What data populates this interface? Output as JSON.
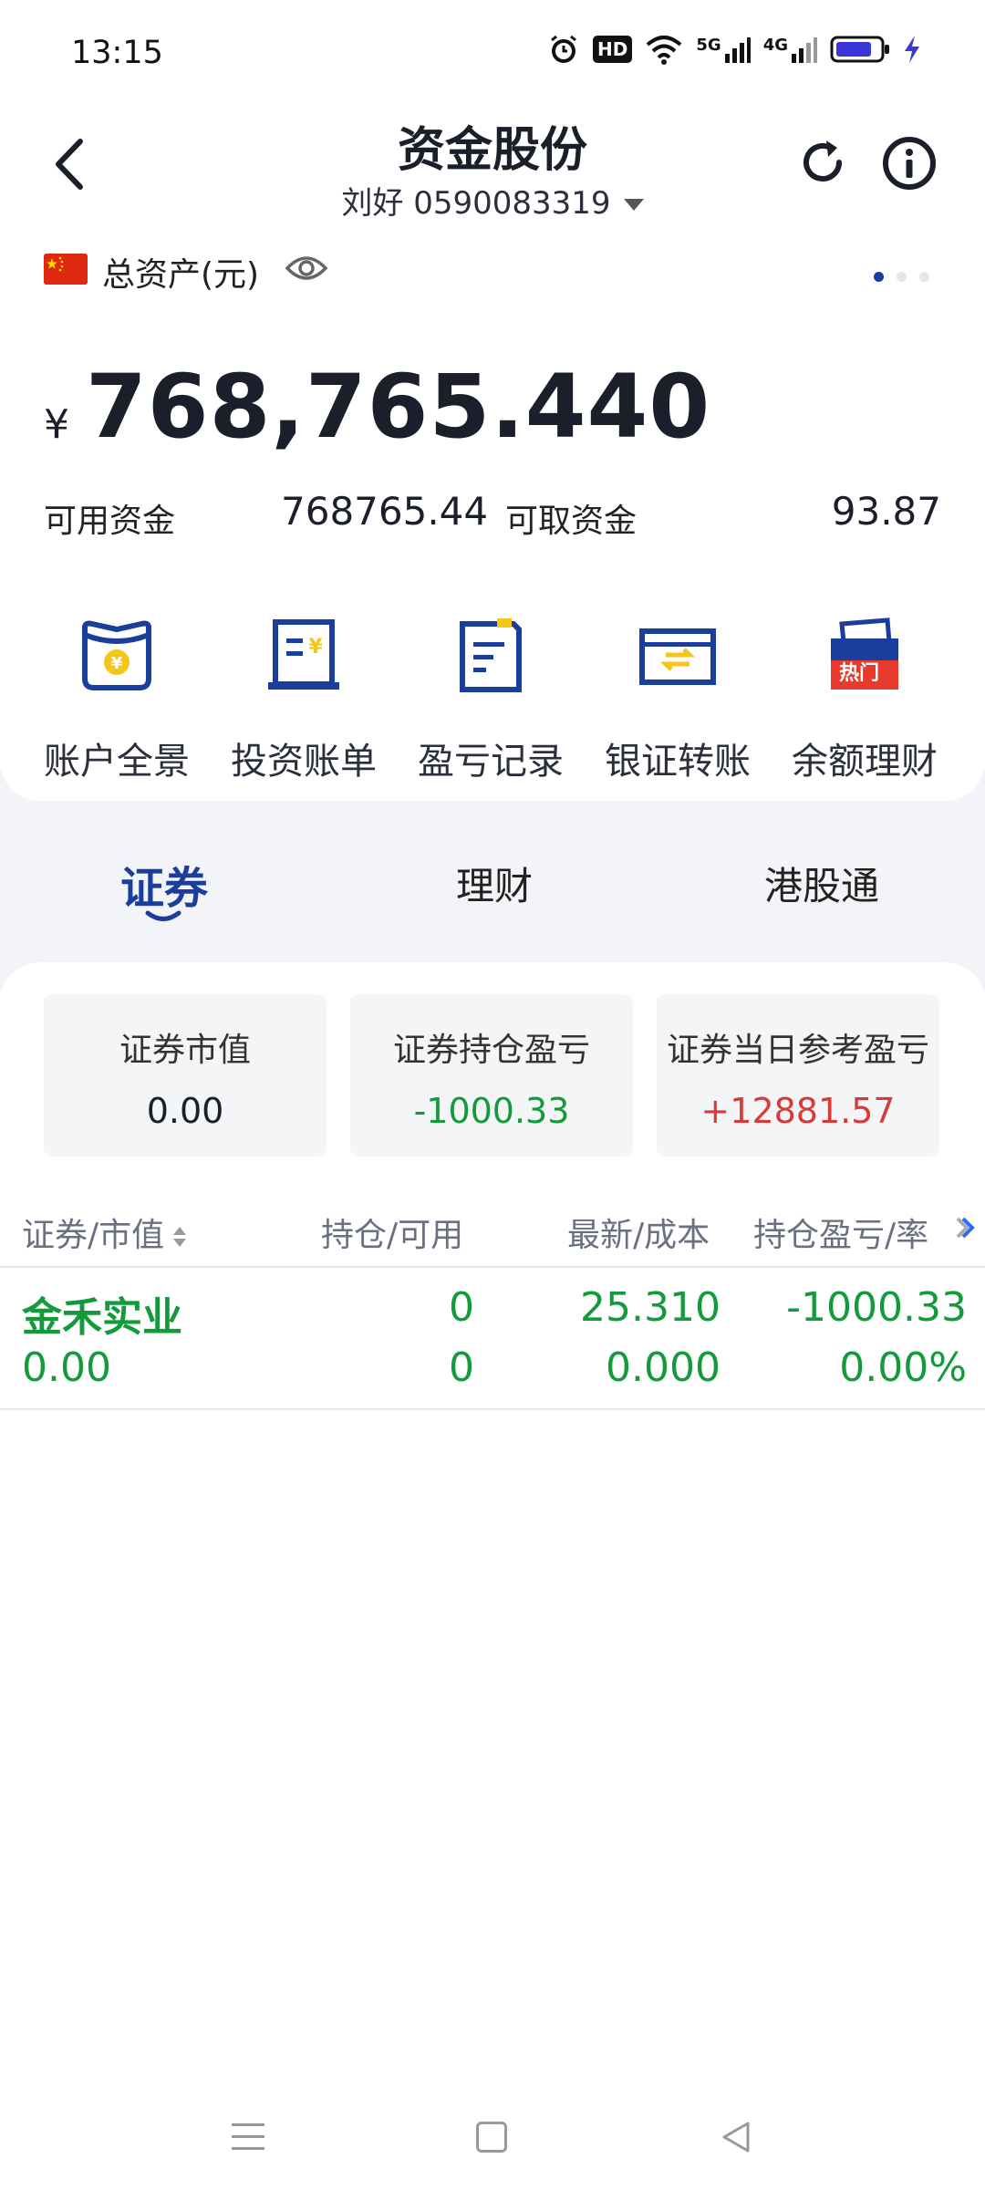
{
  "status_bar": {
    "time": "13:15",
    "hd_label": "HD",
    "net_5g": "5G",
    "net_4g": "4G"
  },
  "header": {
    "title": "资金股份",
    "account": "刘好 0590083319"
  },
  "assets": {
    "label": "总资产(元)",
    "currency_symbol": "¥",
    "total": "768,765.440",
    "available_label": "可用资金",
    "available_value": "768765.44",
    "withdrawable_label": "可取资金",
    "withdrawable_value": "93.87",
    "page_indicator_count": 3,
    "page_indicator_active": 1
  },
  "actions": [
    {
      "label": "账户全景",
      "icon": "wallet-icon"
    },
    {
      "label": "投资账单",
      "icon": "bill-icon"
    },
    {
      "label": "盈亏记录",
      "icon": "record-icon"
    },
    {
      "label": "银证转账",
      "icon": "transfer-icon"
    },
    {
      "label": "余额理财",
      "icon": "finance-icon",
      "badge": "热门"
    }
  ],
  "tabs": [
    {
      "label": "证券",
      "active": true
    },
    {
      "label": "理财",
      "active": false
    },
    {
      "label": "港股通",
      "active": false
    }
  ],
  "summary": [
    {
      "title": "证券市值",
      "value": "0.00",
      "color": "#1a1f2b"
    },
    {
      "title": "证券持仓盈亏",
      "value": "-1000.33",
      "color": "#139a3b"
    },
    {
      "title": "证券当日参考盈亏",
      "value": "+12881.57",
      "color": "#d83a3a"
    }
  ],
  "table": {
    "headers": [
      "证券/市值",
      "持仓/可用",
      "最新/成本",
      "持仓盈亏/率"
    ],
    "rows": [
      {
        "name": "金禾实业",
        "market_value": "0.00",
        "position": "0",
        "available": "0",
        "latest": "25.310",
        "cost": "0.000",
        "pnl": "-1000.33",
        "pnl_rate": "0.00%"
      }
    ]
  },
  "colors": {
    "brand_blue": "#1b3e9c",
    "loss_green": "#139a3b",
    "gain_red": "#d83a3a",
    "accent_yellow": "#f5c518"
  }
}
